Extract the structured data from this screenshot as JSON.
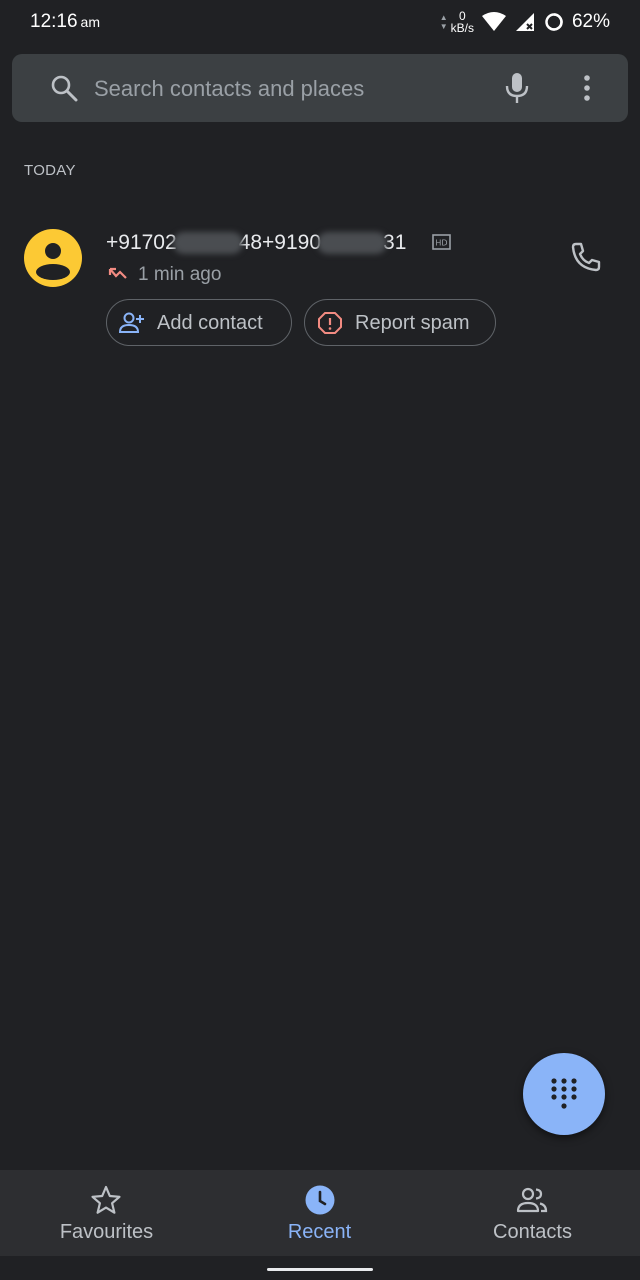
{
  "status_bar": {
    "time": "12:16",
    "ampm": "am",
    "net_speed_value": "0",
    "net_speed_unit": "kB/s",
    "battery": "62%"
  },
  "search": {
    "placeholder": "Search contacts and places"
  },
  "section": {
    "today": "TODAY"
  },
  "call_log": [
    {
      "number_part1": "+91702",
      "number_part2": "48+9190",
      "number_part3": "31",
      "time_ago": "1 min ago",
      "call_type": "missed"
    }
  ],
  "actions": {
    "add_contact": "Add contact",
    "report_spam": "Report spam"
  },
  "nav": {
    "favourites": "Favourites",
    "recent": "Recent",
    "contacts": "Contacts"
  },
  "colors": {
    "background": "#202124",
    "accent": "#8ab4f8",
    "avatar": "#fcc934",
    "missed": "#f28b82"
  }
}
